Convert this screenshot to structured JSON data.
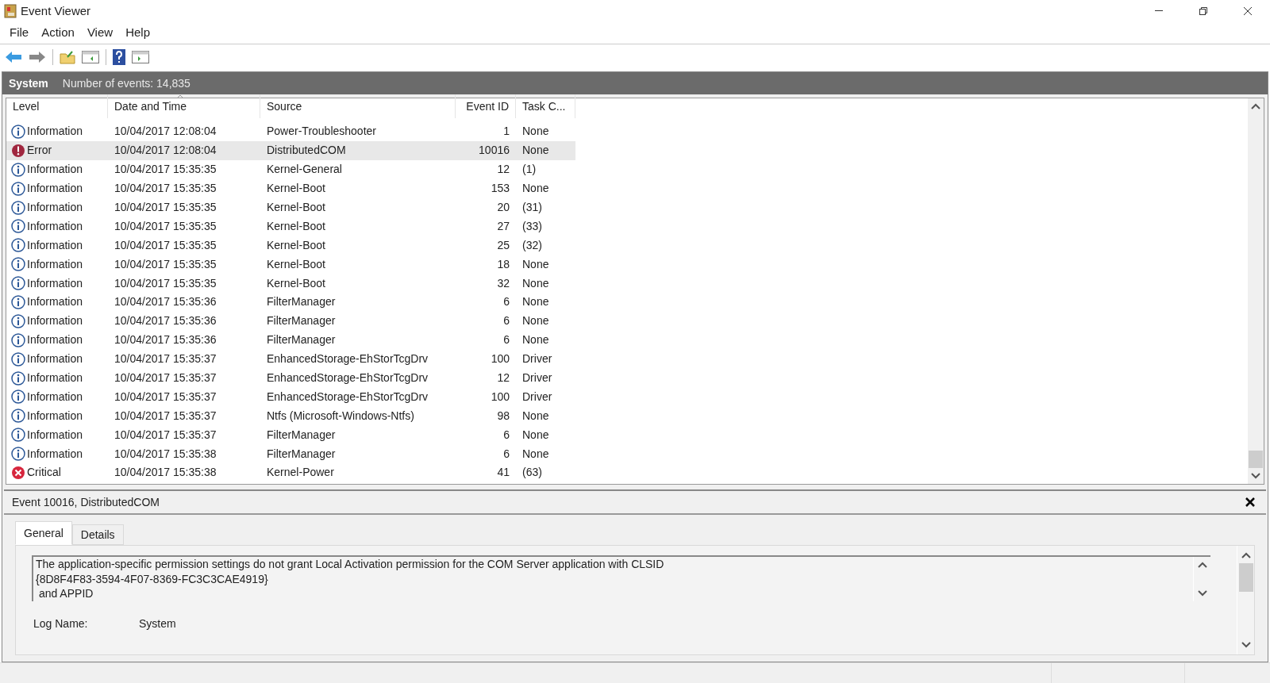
{
  "window": {
    "title": "Event Viewer"
  },
  "menu": [
    "File",
    "Action",
    "View",
    "Help"
  ],
  "log_header": {
    "name": "System",
    "count": "Number of events: 14,835"
  },
  "table": {
    "columns": [
      "Level",
      "Date and Time",
      "Source",
      "Event ID",
      "Task C..."
    ],
    "rows": [
      {
        "kind": "information",
        "level": "Information",
        "date": "10/04/2017 12:08:04",
        "source": "Power-Troubleshooter",
        "event_id": "1",
        "task": "None",
        "selected": false
      },
      {
        "kind": "error",
        "level": "Error",
        "date": "10/04/2017 12:08:04",
        "source": "DistributedCOM",
        "event_id": "10016",
        "task": "None",
        "selected": true
      },
      {
        "kind": "information",
        "level": "Information",
        "date": "10/04/2017 15:35:35",
        "source": "Kernel-General",
        "event_id": "12",
        "task": "(1)",
        "selected": false
      },
      {
        "kind": "information",
        "level": "Information",
        "date": "10/04/2017 15:35:35",
        "source": "Kernel-Boot",
        "event_id": "153",
        "task": "None",
        "selected": false
      },
      {
        "kind": "information",
        "level": "Information",
        "date": "10/04/2017 15:35:35",
        "source": "Kernel-Boot",
        "event_id": "20",
        "task": "(31)",
        "selected": false
      },
      {
        "kind": "information",
        "level": "Information",
        "date": "10/04/2017 15:35:35",
        "source": "Kernel-Boot",
        "event_id": "27",
        "task": "(33)",
        "selected": false
      },
      {
        "kind": "information",
        "level": "Information",
        "date": "10/04/2017 15:35:35",
        "source": "Kernel-Boot",
        "event_id": "25",
        "task": "(32)",
        "selected": false
      },
      {
        "kind": "information",
        "level": "Information",
        "date": "10/04/2017 15:35:35",
        "source": "Kernel-Boot",
        "event_id": "18",
        "task": "None",
        "selected": false
      },
      {
        "kind": "information",
        "level": "Information",
        "date": "10/04/2017 15:35:35",
        "source": "Kernel-Boot",
        "event_id": "32",
        "task": "None",
        "selected": false
      },
      {
        "kind": "information",
        "level": "Information",
        "date": "10/04/2017 15:35:36",
        "source": "FilterManager",
        "event_id": "6",
        "task": "None",
        "selected": false
      },
      {
        "kind": "information",
        "level": "Information",
        "date": "10/04/2017 15:35:36",
        "source": "FilterManager",
        "event_id": "6",
        "task": "None",
        "selected": false
      },
      {
        "kind": "information",
        "level": "Information",
        "date": "10/04/2017 15:35:36",
        "source": "FilterManager",
        "event_id": "6",
        "task": "None",
        "selected": false
      },
      {
        "kind": "information",
        "level": "Information",
        "date": "10/04/2017 15:35:37",
        "source": "EnhancedStorage-EhStorTcgDrv",
        "event_id": "100",
        "task": "Driver",
        "selected": false
      },
      {
        "kind": "information",
        "level": "Information",
        "date": "10/04/2017 15:35:37",
        "source": "EnhancedStorage-EhStorTcgDrv",
        "event_id": "12",
        "task": "Driver",
        "selected": false
      },
      {
        "kind": "information",
        "level": "Information",
        "date": "10/04/2017 15:35:37",
        "source": "EnhancedStorage-EhStorTcgDrv",
        "event_id": "100",
        "task": "Driver",
        "selected": false
      },
      {
        "kind": "information",
        "level": "Information",
        "date": "10/04/2017 15:35:37",
        "source": "Ntfs (Microsoft-Windows-Ntfs)",
        "event_id": "98",
        "task": "None",
        "selected": false
      },
      {
        "kind": "information",
        "level": "Information",
        "date": "10/04/2017 15:35:37",
        "source": "FilterManager",
        "event_id": "6",
        "task": "None",
        "selected": false
      },
      {
        "kind": "information",
        "level": "Information",
        "date": "10/04/2017 15:35:38",
        "source": "FilterManager",
        "event_id": "6",
        "task": "None",
        "selected": false
      },
      {
        "kind": "critical",
        "level": "Critical",
        "date": "10/04/2017 15:35:38",
        "source": "Kernel-Power",
        "event_id": "41",
        "task": "(63)",
        "selected": false
      }
    ]
  },
  "detail": {
    "title": "Event 10016, DistributedCOM",
    "tabs": [
      {
        "label": "General",
        "selected": true
      },
      {
        "label": "Details",
        "selected": false
      }
    ],
    "description": [
      "The application-specific permission settings do not grant Local Activation permission for the COM Server application with CLSID",
      "{8D8F4F83-3594-4F07-8369-FC3C3CAE4919}",
      " and APPID"
    ],
    "fields": [
      {
        "label": "Log Name:",
        "value": "System"
      }
    ]
  }
}
